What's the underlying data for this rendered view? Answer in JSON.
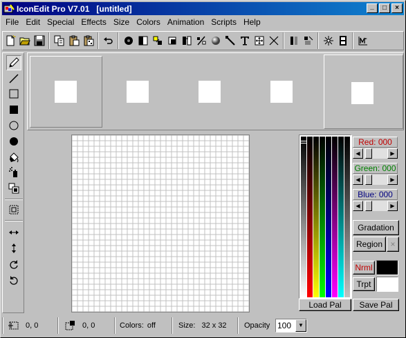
{
  "window": {
    "title": "IconEdit Pro V7.01   [untitled]",
    "minimize_glyph": "_",
    "maximize_glyph": "□",
    "close_glyph": "×"
  },
  "menu": [
    "File",
    "Edit",
    "Special",
    "Effects",
    "Size",
    "Colors",
    "Animation",
    "Scripts",
    "Help"
  ],
  "toolbar_icons": [
    "new-icon",
    "open-icon",
    "save-icon",
    "copy-icon",
    "paste-icon",
    "paste-special-icon",
    "undo-icon",
    "circle-brush-icon",
    "half-fill-icon",
    "color-replace-icon",
    "square-brush-icon",
    "flip-icon",
    "rotate-icon",
    "sphere-icon",
    "wand-icon",
    "text-icon",
    "move-icon",
    "clear-icon",
    "split-icon",
    "mirror-icon",
    "sparkle-icon",
    "film-icon",
    "script-icon"
  ],
  "left_tools": [
    "pencil-icon",
    "line-icon",
    "rectangle-icon",
    "filled-rectangle-icon",
    "ellipse-icon",
    "filled-ellipse-icon",
    "fill-bucket-icon",
    "spray-icon",
    "copy-region-icon",
    "select-icon",
    "flip-horizontal-icon",
    "flip-vertical-icon",
    "rotate-cw-icon",
    "rotate-ccw-icon"
  ],
  "colors": {
    "red_label": "Red: 000",
    "green_label": "Green: 000",
    "blue_label": "Blue: 000",
    "red_value": 0,
    "green_value": 0,
    "blue_value": 0,
    "red_text_color": "#c00000",
    "green_text_color": "#008000",
    "blue_text_color": "#000080"
  },
  "buttons": {
    "gradation": "Gradation",
    "region": "Region",
    "region_clear": "×",
    "nrml": "Nrml",
    "trpt": "Trpt",
    "load_pal": "Load Pal",
    "save_pal": "Save Pal"
  },
  "status": {
    "cursor_pos": "0, 0",
    "selection_pos": "0, 0",
    "colors_label": "Colors:",
    "colors_value": "off",
    "size_label": "Size:",
    "size_value": "32 x 32",
    "opacity_label": "Opacity",
    "opacity_value": "100",
    "opacity_arrow": "▼"
  },
  "palette_columns": [
    "#ffffff",
    "#ff0000",
    "#ffff00",
    "#00ff00",
    "#0000ff",
    "#ff00ff",
    "#00ffff",
    "#c0c0c0"
  ]
}
